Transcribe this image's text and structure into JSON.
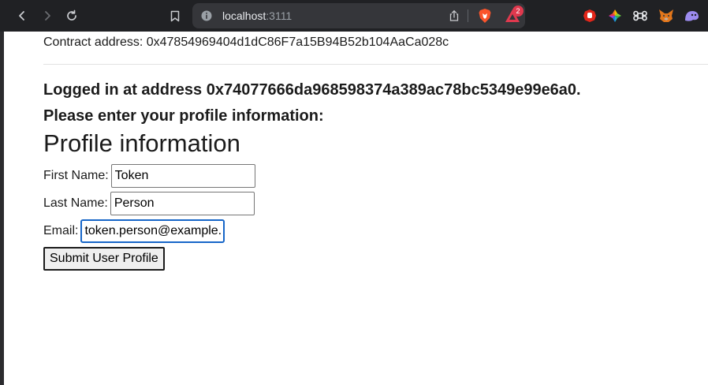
{
  "browser": {
    "url_host": "localhost",
    "url_port": ":3111",
    "rewards_badge": "2",
    "icons": {
      "back": "back-arrow-icon",
      "forward": "forward-arrow-icon",
      "reload": "reload-icon",
      "bookmark": "bookmark-icon",
      "site_info": "info-icon",
      "share": "share-icon",
      "brave_shields": "brave-shields-icon",
      "rewards": "brave-rewards-icon",
      "extensions": [
        "stop-hand-extension-icon",
        "colorwheel-extension-icon",
        "command-extension-icon",
        "metamask-fox-icon",
        "ghost-extension-icon"
      ]
    }
  },
  "page": {
    "contract_text": "Contract address: 0x47854969404d1dC86F7a15B94B52b104AaCa028c",
    "logged_in_text": "Logged in at address 0x74077666da968598374a389ac78bc5349e99e6a0.",
    "prompt_text": "Please enter your profile information:",
    "profile_heading": "Profile information",
    "form": {
      "first_name_label": "First Name:",
      "first_name_value": "Token",
      "last_name_label": "Last Name:",
      "last_name_value": "Person",
      "email_label": "Email:",
      "email_value": "token.person@example.",
      "submit_label": "Submit User Profile"
    }
  }
}
